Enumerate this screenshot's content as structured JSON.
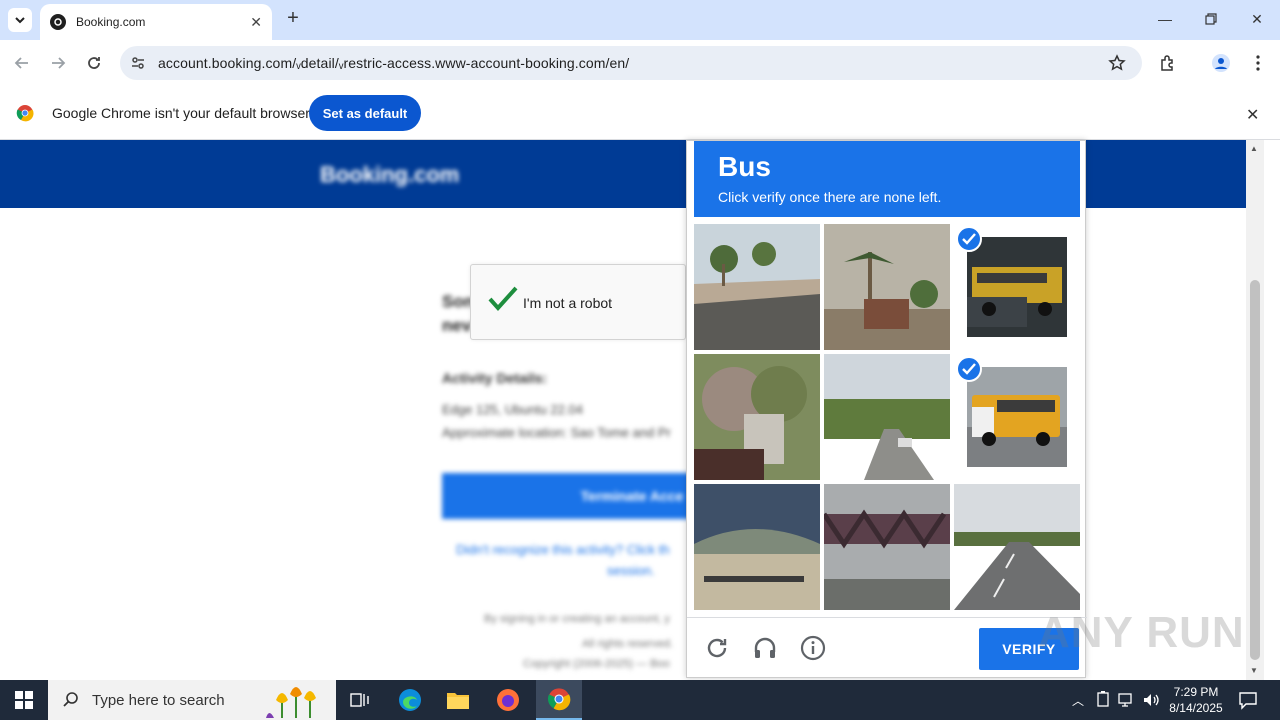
{
  "browser": {
    "tab_title": "Booking.com",
    "url": "account.booking.com/ᵥdetail/ᵥrestric-access.www-account-booking.com/en/",
    "infobar_text": "Google Chrome isn't your default browser",
    "set_default_label": "Set as default"
  },
  "page": {
    "brand": "Booking.com",
    "heading_partial": "Son",
    "heading_partial2": "nev",
    "activity_label": "Activity Details:",
    "device": "Edge 125, Ubuntu 22.04",
    "location": "Approximate location: Sao Tome and Pr",
    "terminate_label": "Terminate Acce",
    "recognize_text": "Didn't recognize this activity? Click th",
    "recognize_text2": "session.",
    "footer1": "By signing in or creating an account, y",
    "footer2": "All rights reserved.",
    "footer3": "Copyright (2006-2025) — Boo"
  },
  "recaptcha_checkbox": {
    "label": "I'm not a robot"
  },
  "captcha": {
    "target_word": "Bus",
    "instruction": "Click verify once there are none left.",
    "verify_label": "VERIFY",
    "tiles": [
      {
        "desc": "street-palms",
        "selected": false
      },
      {
        "desc": "palm-trees",
        "selected": false
      },
      {
        "desc": "school-bus-dark",
        "selected": true
      },
      {
        "desc": "tree-car",
        "selected": false
      },
      {
        "desc": "road-trees",
        "selected": false
      },
      {
        "desc": "school-bus",
        "selected": true
      },
      {
        "desc": "bus-roof",
        "selected": false
      },
      {
        "desc": "bridge",
        "selected": false
      },
      {
        "desc": "highway",
        "selected": false
      }
    ]
  },
  "watermark": "ANY RUN",
  "taskbar": {
    "search_placeholder": "Type here to search",
    "time": "7:29 PM",
    "date": "8/14/2025"
  },
  "colors": {
    "brand_blue": "#003b95",
    "captcha_blue": "#1a73e8",
    "chrome_blue": "#0b57d0"
  }
}
